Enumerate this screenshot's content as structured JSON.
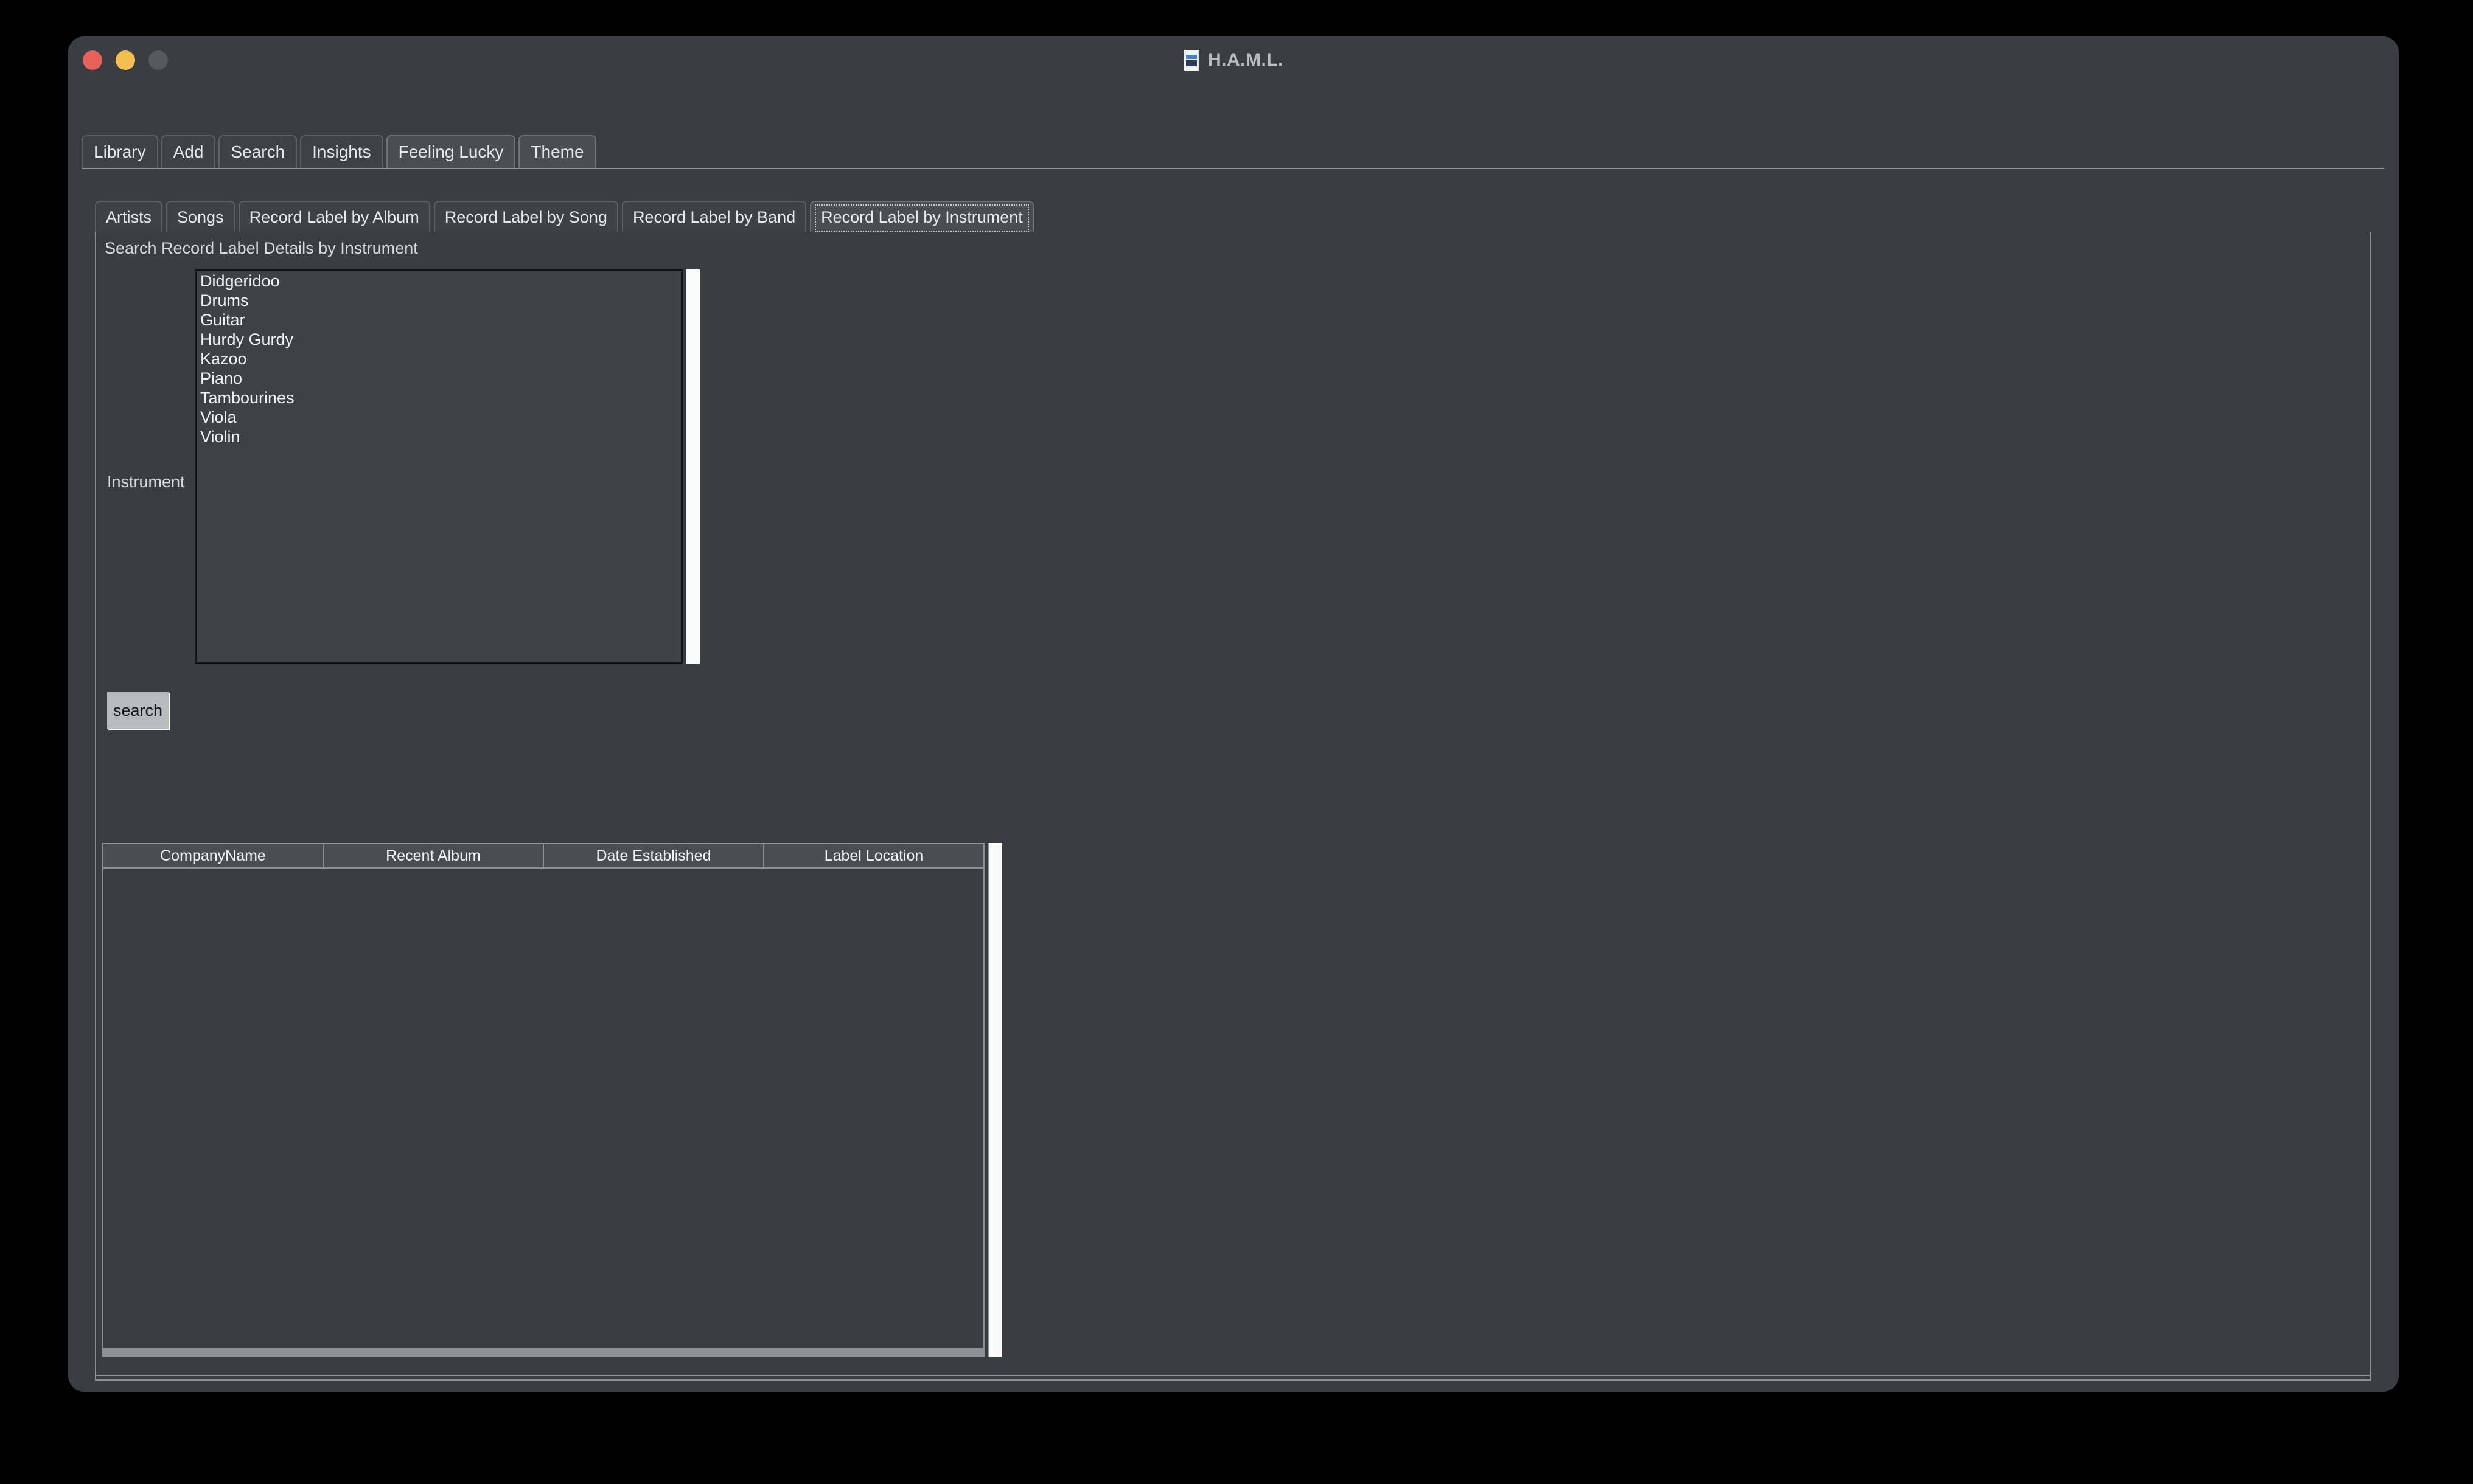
{
  "window": {
    "title": "H.A.M.L.",
    "doc_icon": "document-icon",
    "controls": {
      "close": "close-button",
      "minimize": "minimize-button",
      "zoom": "zoom-button"
    }
  },
  "top_tabs": [
    {
      "label": "Library",
      "active": false
    },
    {
      "label": "Add",
      "active": false
    },
    {
      "label": "Search",
      "active": false
    },
    {
      "label": "Insights",
      "active": false
    },
    {
      "label": "Feeling Lucky",
      "active": true
    },
    {
      "label": "Theme",
      "active": true
    }
  ],
  "sub_tabs": [
    {
      "label": "Artists",
      "active": false
    },
    {
      "label": "Songs",
      "active": false
    },
    {
      "label": "Record Label by Album",
      "active": false
    },
    {
      "label": "Record Label by Song",
      "active": false
    },
    {
      "label": "Record Label by Band",
      "active": false
    },
    {
      "label": "Record Label by Instrument",
      "active": true
    }
  ],
  "panel": {
    "heading": "Search Record Label Details by Instrument",
    "field_label": "Instrument",
    "search_button": "search"
  },
  "instrument_list": {
    "items": [
      "Didgeridoo",
      "Drums",
      "Guitar",
      "Hurdy Gurdy",
      "Kazoo",
      "Piano",
      "Tambourines",
      "Viola",
      "Violin"
    ],
    "selected": null
  },
  "results_table": {
    "columns": [
      "CompanyName",
      "Recent Album",
      "Date Established",
      "Label Location"
    ],
    "rows": []
  },
  "colors": {
    "window_bg": "#3a3d42",
    "panel_border": "#8e9297",
    "tab_active_bg": "#4a4e53",
    "tab_bg": "#3e4146",
    "text": "#e6e8ea",
    "button_bg": "#b9babc",
    "button_text": "#16181a",
    "scrollbar": "#fafafa",
    "listbox_border": "#121316",
    "traffic_close": "#e8615a",
    "traffic_min": "#f5bf4f",
    "traffic_zoom": "#555a5e"
  }
}
